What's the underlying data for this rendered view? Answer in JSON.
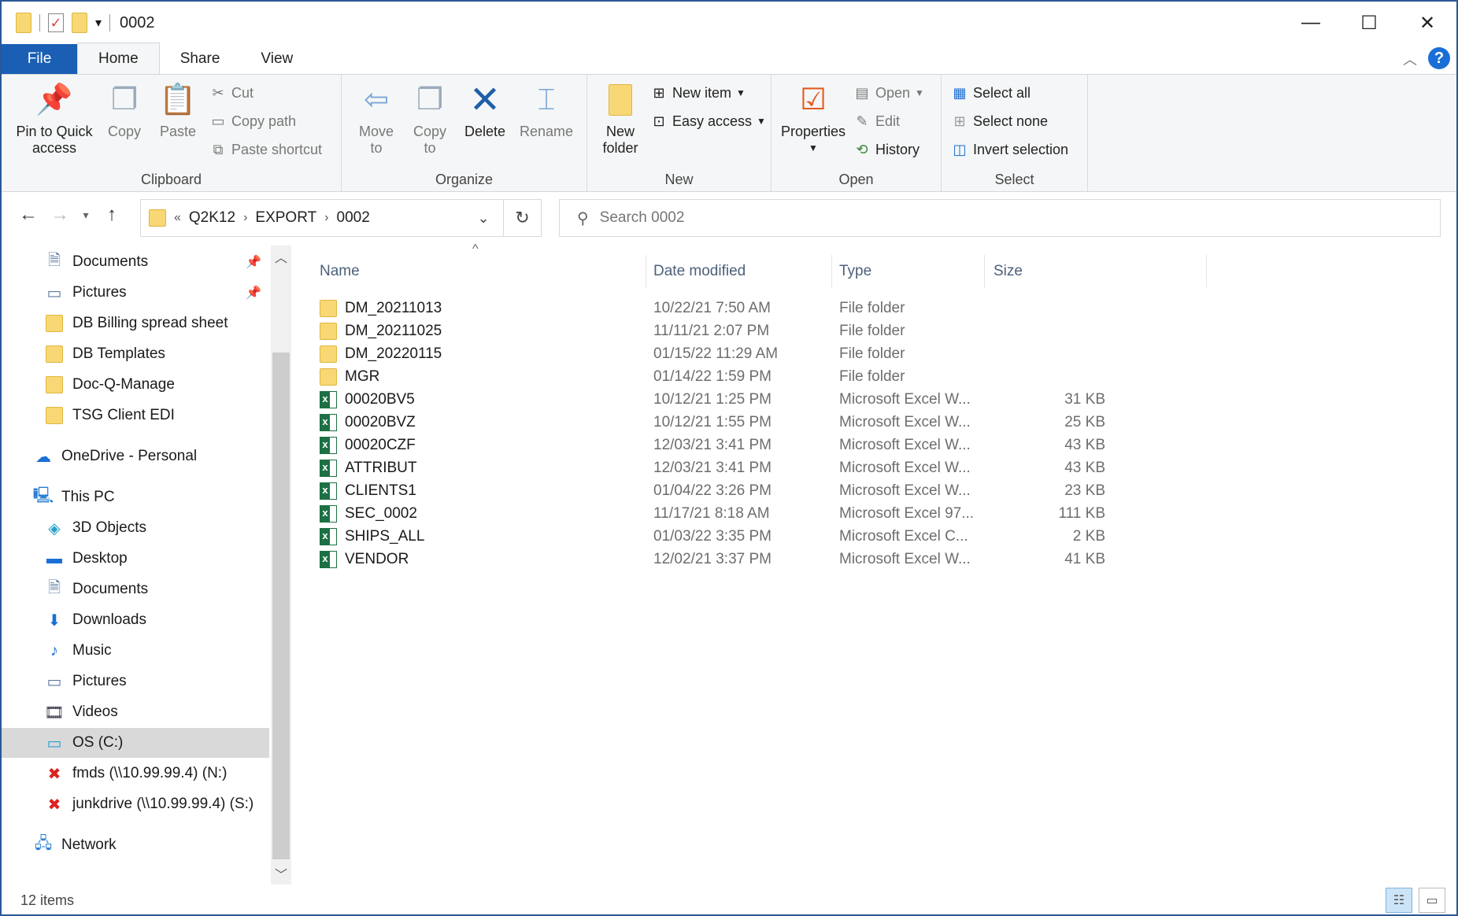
{
  "window": {
    "title": "0002",
    "minimize_glyph": "—",
    "maximize_glyph": "☐",
    "close_glyph": "✕"
  },
  "ribbon_tabs": [
    "File",
    "Home",
    "Share",
    "View"
  ],
  "ribbon": {
    "clipboard": {
      "label": "Clipboard",
      "pin": "Pin to Quick access",
      "copy": "Copy",
      "paste": "Paste",
      "cut": "Cut",
      "copy_path": "Copy path",
      "paste_shortcut": "Paste shortcut"
    },
    "organize": {
      "label": "Organize",
      "move_to": "Move to",
      "copy_to": "Copy to",
      "delete": "Delete",
      "rename": "Rename"
    },
    "new": {
      "label": "New",
      "new_folder": "New folder",
      "new_item": "New item",
      "easy_access": "Easy access"
    },
    "open": {
      "label": "Open",
      "properties": "Properties",
      "open": "Open",
      "edit": "Edit",
      "history": "History"
    },
    "select": {
      "label": "Select",
      "select_all": "Select all",
      "select_none": "Select none",
      "invert": "Invert selection"
    }
  },
  "address": {
    "prefix": "«",
    "crumbs": [
      "Q2K12",
      "EXPORT",
      "0002"
    ]
  },
  "search": {
    "placeholder": "Search 0002"
  },
  "nav": {
    "quick_access": [
      {
        "label": "Documents",
        "icon": "documents-icon",
        "pinned": true
      },
      {
        "label": "Pictures",
        "icon": "pictures-icon",
        "pinned": true
      },
      {
        "label": "DB Billing spread sheet",
        "icon": "folder-icon"
      },
      {
        "label": "DB Templates",
        "icon": "folder-icon"
      },
      {
        "label": "Doc-Q-Manage",
        "icon": "folder-icon"
      },
      {
        "label": "TSG Client EDI",
        "icon": "folder-icon"
      }
    ],
    "onedrive": "OneDrive - Personal",
    "this_pc": "This PC",
    "pc_items": [
      {
        "label": "3D Objects",
        "icon": "3d-objects-icon"
      },
      {
        "label": "Desktop",
        "icon": "desktop-icon"
      },
      {
        "label": "Documents",
        "icon": "documents-icon"
      },
      {
        "label": "Downloads",
        "icon": "downloads-icon"
      },
      {
        "label": "Music",
        "icon": "music-icon"
      },
      {
        "label": "Pictures",
        "icon": "pictures-icon"
      },
      {
        "label": "Videos",
        "icon": "videos-icon"
      },
      {
        "label": "OS (C:)",
        "icon": "drive-icon",
        "selected": true
      },
      {
        "label": "fmds (\\\\10.99.99.4) (N:)",
        "icon": "network-drive-disconnected-icon"
      },
      {
        "label": "junkdrive (\\\\10.99.99.4) (S:)",
        "icon": "network-drive-disconnected-icon"
      }
    ],
    "network": "Network"
  },
  "columns": {
    "name": "Name",
    "date": "Date modified",
    "type": "Type",
    "size": "Size"
  },
  "files": [
    {
      "name": "DM_20211013",
      "date": "10/22/21 7:50 AM",
      "type": "File folder",
      "size": "",
      "kind": "folder"
    },
    {
      "name": "DM_20211025",
      "date": "11/11/21 2:07 PM",
      "type": "File folder",
      "size": "",
      "kind": "folder"
    },
    {
      "name": "DM_20220115",
      "date": "01/15/22 11:29 AM",
      "type": "File folder",
      "size": "",
      "kind": "folder"
    },
    {
      "name": "MGR",
      "date": "01/14/22 1:59 PM",
      "type": "File folder",
      "size": "",
      "kind": "folder"
    },
    {
      "name": "00020BV5",
      "date": "10/12/21 1:25 PM",
      "type": "Microsoft Excel W...",
      "size": "31 KB",
      "kind": "excel"
    },
    {
      "name": "00020BVZ",
      "date": "10/12/21 1:55 PM",
      "type": "Microsoft Excel W...",
      "size": "25 KB",
      "kind": "excel"
    },
    {
      "name": "00020CZF",
      "date": "12/03/21 3:41 PM",
      "type": "Microsoft Excel W...",
      "size": "43 KB",
      "kind": "excel"
    },
    {
      "name": "ATTRIBUT",
      "date": "12/03/21 3:41 PM",
      "type": "Microsoft Excel W...",
      "size": "43 KB",
      "kind": "excel"
    },
    {
      "name": "CLIENTS1",
      "date": "01/04/22 3:26 PM",
      "type": "Microsoft Excel W...",
      "size": "23 KB",
      "kind": "excel"
    },
    {
      "name": "SEC_0002",
      "date": "11/17/21 8:18 AM",
      "type": "Microsoft Excel 97...",
      "size": "111 KB",
      "kind": "excel"
    },
    {
      "name": "SHIPS_ALL",
      "date": "01/03/22 3:35 PM",
      "type": "Microsoft Excel C...",
      "size": "2 KB",
      "kind": "excel"
    },
    {
      "name": "VENDOR",
      "date": "12/02/21 3:37 PM",
      "type": "Microsoft Excel W...",
      "size": "41 KB",
      "kind": "excel"
    }
  ],
  "status": {
    "count": "12 items"
  }
}
